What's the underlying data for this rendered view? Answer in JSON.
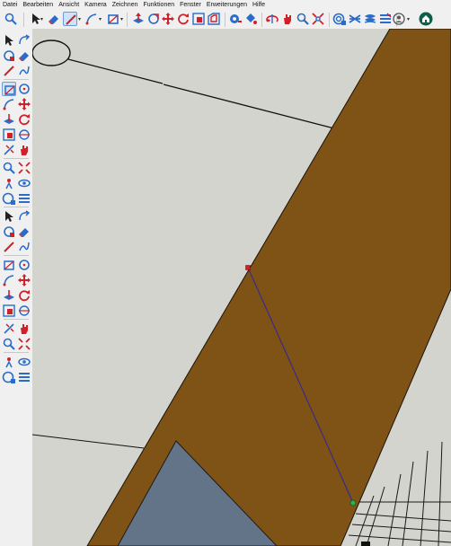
{
  "menu": {
    "items": [
      "Datei",
      "Bearbeiten",
      "Ansicht",
      "Kamera",
      "Zeichnen",
      "Funktionen",
      "Fenster",
      "Erweiterungen",
      "Hilfe"
    ]
  },
  "toolbar": {
    "icons": [
      "search-icon",
      "select-arrow-icon",
      "eraser-icon",
      "pencil-line-icon",
      "arc-icon",
      "rectangle-icon",
      "push-pull-icon",
      "follow-me-icon",
      "move-icon",
      "rotate-icon",
      "scale-icon",
      "section-plane-icon",
      "orbit-icon",
      "paint-bucket-icon",
      "zoom-icon",
      "zoom-extents-icon",
      "components-icon",
      "materials-icon",
      "styles-icon",
      "layers-icon",
      "account-icon",
      "extension-warehouse-icon"
    ]
  },
  "colors": {
    "ui_background": "#f0f0f0",
    "model_background": "#d4d4cf",
    "brown_surface": "#7f5315",
    "blue_gray_surface": "#647488",
    "accent_red": "#d0202a",
    "accent_blue": "#2a6cc8",
    "guide_line": "#3a2a8c",
    "inference_point": "#2bb34a"
  },
  "left_toolbar": {
    "rows": [
      [
        "select-arrow-icon",
        "lasso-select-icon"
      ],
      [
        "paint-bucket-icon",
        "eraser-icon"
      ],
      [
        "components-icon",
        "tag-eraser-icon"
      ],
      [
        "pencil-line-icon",
        "freehand-icon"
      ],
      [
        "rectangle-icon",
        "rotated-rectangle-icon"
      ],
      [
        "circle-icon",
        "polygon-icon"
      ],
      [
        "arc-icon",
        "two-point-arc-icon"
      ],
      [
        "three-point-arc-icon",
        "pie-icon"
      ],
      [
        "move-icon",
        "push-pull-icon"
      ],
      [
        "rotate-icon",
        "follow-me-icon"
      ],
      [
        "scale-icon",
        "offset-icon"
      ],
      [
        "tape-measure-icon",
        "dimension-icon"
      ],
      [
        "protractor-icon",
        "text-icon"
      ],
      [
        "axes-icon",
        "3d-text-icon"
      ],
      [
        "section-plane-icon",
        "section-display-icon"
      ],
      [
        "orbit-icon",
        "pan-icon"
      ],
      [
        "zoom-icon",
        "zoom-window-icon"
      ],
      [
        "zoom-extents-icon",
        "previous-view-icon"
      ],
      [
        "position-camera-icon",
        "walk-icon"
      ],
      [
        "look-around-icon",
        "sandbox-icon"
      ],
      [
        "components-icon",
        "styles-icon"
      ],
      [
        "layers-icon",
        "scenes-icon"
      ]
    ]
  }
}
